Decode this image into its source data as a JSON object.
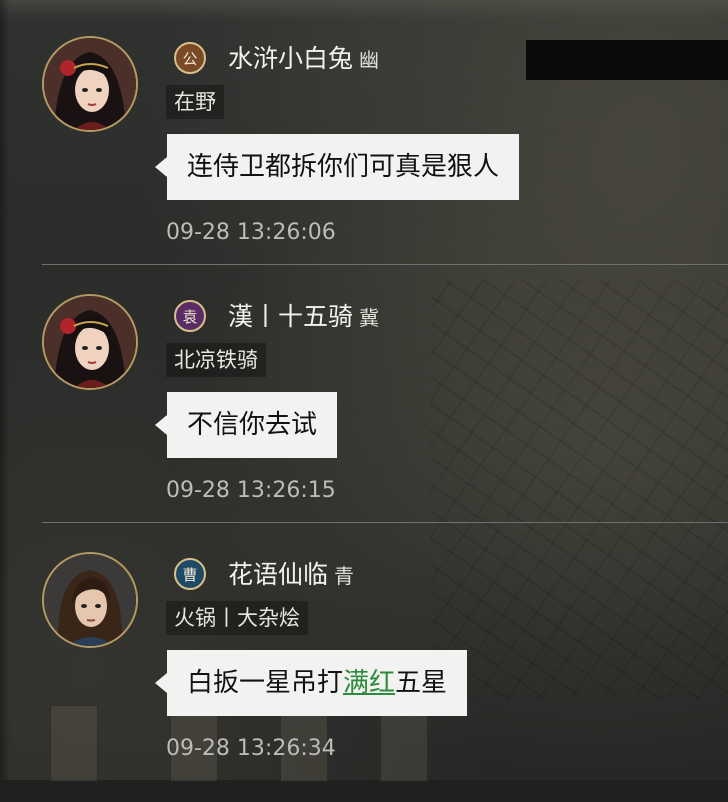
{
  "messages": [
    {
      "badge": "公",
      "badge_color": "#7a4a26",
      "name": "水浒小白兔",
      "name_suffix": "幽",
      "tag": "在野",
      "text": "连侍卫都拆你们可真是狠人",
      "time": "09-28 13:26:06",
      "avatar_icon": "female-warrior-avatar"
    },
    {
      "badge": "袁",
      "badge_color": "#5a2c66",
      "name": "漢丨十五骑",
      "name_suffix": "冀",
      "tag": "北凉铁骑",
      "text": "不信你去试",
      "time": "09-28 13:26:15",
      "avatar_icon": "female-warrior-avatar"
    },
    {
      "badge": "曹",
      "badge_color": "#1f4a66",
      "name": "花语仙临",
      "name_suffix": "青",
      "tag": "火锅丨大杂烩",
      "text_before": "白扳一星吊打",
      "text_highlight": "满红",
      "text_after": "五星",
      "time": "09-28 13:26:34",
      "avatar_icon": "male-warrior-avatar"
    }
  ]
}
